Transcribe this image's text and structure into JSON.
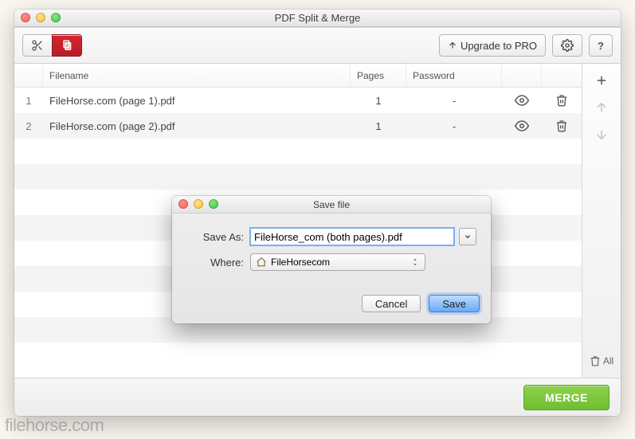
{
  "window": {
    "title": "PDF Split & Merge"
  },
  "toolbar": {
    "upgrade_label": "Upgrade to PRO"
  },
  "table": {
    "headers": {
      "index": "",
      "filename": "Filename",
      "pages": "Pages",
      "password": "Password"
    },
    "rows": [
      {
        "index": "1",
        "filename": "FileHorse.com (page 1).pdf",
        "pages": "1",
        "password": "-"
      },
      {
        "index": "2",
        "filename": "FileHorse.com (page 2).pdf",
        "pages": "1",
        "password": "-"
      }
    ]
  },
  "sidepanel": {
    "remove_all_label": "All"
  },
  "footer": {
    "merge_label": "MERGE"
  },
  "dialog": {
    "title": "Save file",
    "save_as_label": "Save As:",
    "filename_value": "FileHorse_com (both pages).pdf",
    "where_label": "Where:",
    "where_value": "FileHorsecom",
    "cancel_label": "Cancel",
    "save_label": "Save"
  },
  "watermark": {
    "text_a": "filehorse",
    "text_b": "com"
  }
}
